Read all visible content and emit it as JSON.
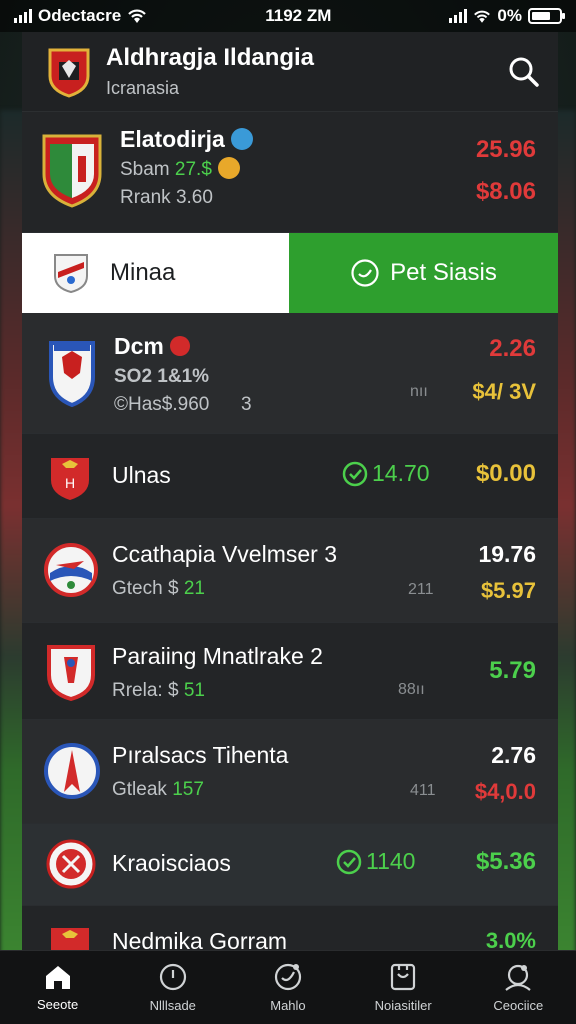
{
  "status": {
    "carrier": "Odectacre",
    "time": "1192 ZM",
    "battery": "0%"
  },
  "header": {
    "title": "Aldhragja Ildangia",
    "subtitle": "Icranasia"
  },
  "matches": [
    {
      "name": "Elatodirja",
      "sub1_label": "Sbam",
      "sub1_value": "27.$",
      "sub2": "Rrank 3.60",
      "right_top": "25.96",
      "right_bottom": "$8.06"
    },
    {
      "name": "Dcm",
      "sub1_value": "SO2 1&1%",
      "sub2": "©Has$.960",
      "sub2_extra": "3",
      "mid_extra": "nıı",
      "right_top": "2.26",
      "right_bottom": "$4/ 3V"
    },
    {
      "name": "Ulnas",
      "mid_value": "14.70",
      "right_value": "$0.00"
    },
    {
      "name": "Ccathapia Vvelmser 3",
      "sub1_label": "Gtech $",
      "sub1_value": "21",
      "mid_extra": "211",
      "right_top": "19.76",
      "right_bottom": "$5.97"
    },
    {
      "name": "Paraiing Mnatlrake 2",
      "sub1_label": "Rrela: $",
      "sub1_value": "51",
      "mid_extra": "88ıı",
      "right_value": "5.79"
    },
    {
      "name": "Pıralsacs Tihenta",
      "sub1_label": "Gtleak",
      "sub1_value": "157",
      "mid_extra": "411",
      "right_top": "2.76",
      "right_bottom": "$4,0.0"
    },
    {
      "name": "Kraoisciaos",
      "mid_value": "1140",
      "right_value": "$5.36"
    },
    {
      "name": "Nedmika Gorram",
      "right_top": "3.0%"
    }
  ],
  "promo": {
    "left_label": "Minaa",
    "right_label": "Pet Siasis"
  },
  "tabs": [
    {
      "label": "Seeote",
      "icon": "home-icon"
    },
    {
      "label": "Nlllsade",
      "icon": "clock-icon"
    },
    {
      "label": "Mahlo",
      "icon": "ball-icon"
    },
    {
      "label": "Noiasitiler",
      "icon": "ticket-icon"
    },
    {
      "label": "Ceociice",
      "icon": "profile-icon"
    }
  ],
  "colors": {
    "accent_green": "#2e9f2e",
    "positive": "#4cd04c",
    "negative": "#e03a3a",
    "warning": "#e8c23a",
    "panel": "#1d1f21"
  }
}
